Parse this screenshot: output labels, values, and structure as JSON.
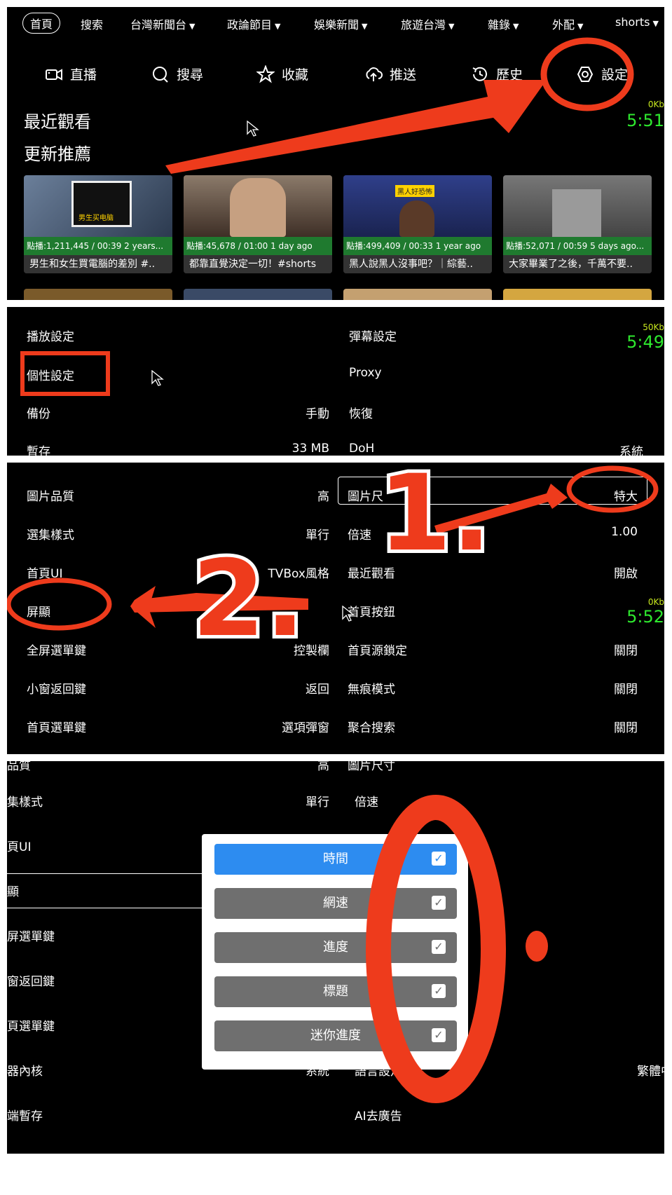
{
  "panel1": {
    "nav_tabs": [
      {
        "label": "首頁",
        "filter": ""
      },
      {
        "label": "搜索",
        "filter": ""
      },
      {
        "label": "台灣新聞台",
        "filter": "▼"
      },
      {
        "label": "政論節目",
        "filter": "▼"
      },
      {
        "label": "娛樂新聞",
        "filter": "▼"
      },
      {
        "label": "旅遊台灣",
        "filter": "▼"
      },
      {
        "label": "雜錄",
        "filter": "▼"
      },
      {
        "label": "外配",
        "filter": "▼"
      },
      {
        "label": "shorts",
        "filter": "▼"
      }
    ],
    "actions": [
      {
        "label": "直播",
        "icon": "camera-icon"
      },
      {
        "label": "搜尋",
        "icon": "search-icon"
      },
      {
        "label": "收藏",
        "icon": "star-icon"
      },
      {
        "label": "推送",
        "icon": "cloud-upload-icon"
      },
      {
        "label": "歷史",
        "icon": "history-icon"
      },
      {
        "label": "設定",
        "icon": "gear-icon"
      }
    ],
    "recent_title": "最近觀看",
    "recommend_title": "更新推薦",
    "speed": "0Kb",
    "clock": "5:51",
    "cards": [
      {
        "meta": "點播:1,211,445 / 00:39 2 years...",
        "title": "男生和女生買電腦的差別 #..",
        "thumb_text": "男生买电脑"
      },
      {
        "meta": "點播:45,678 / 01:00 1 day ago",
        "title": "都靠直覺決定一切！#shorts",
        "thumb_text": ""
      },
      {
        "meta": "點播:499,409 / 00:33 1 year ago",
        "title": "黑人說黑人沒事吧？｜綜藝..",
        "thumb_text": "黑人好恐怖"
      },
      {
        "meta": "點播:52,071 / 00:59 5 days ago...",
        "title": "大家畢業了之後，千萬不要..",
        "thumb_text": ""
      }
    ]
  },
  "panel2": {
    "speed": "50Kb",
    "clock": "5:49",
    "left_rows": [
      {
        "label": "播放設定",
        "value": ""
      },
      {
        "label": "個性設定",
        "value": ""
      },
      {
        "label": "備份",
        "value": "手動"
      },
      {
        "label": "暫存",
        "value": "33 MB"
      }
    ],
    "right_rows": [
      {
        "label": "彈幕設定",
        "value": ""
      },
      {
        "label": "Proxy",
        "value": ""
      },
      {
        "label": "恢復",
        "value": ""
      },
      {
        "label": "DoH",
        "value": "系統"
      }
    ]
  },
  "panel3": {
    "speed": "0Kb",
    "clock": "5:52",
    "annotation_1": "1.",
    "annotation_2": "2.",
    "left_rows": [
      {
        "label": "圖片品質",
        "value": "高"
      },
      {
        "label": "選集樣式",
        "value": "單行"
      },
      {
        "label": "首頁UI",
        "value": "TVBox風格"
      },
      {
        "label": "屏顯",
        "value": ""
      },
      {
        "label": "全屏選單鍵",
        "value": "控製欄"
      },
      {
        "label": "小窗返回鍵",
        "value": "返回"
      },
      {
        "label": "首頁選單鍵",
        "value": "選項彈窗"
      }
    ],
    "right_rows": [
      {
        "label": "圖片尺",
        "value": "特大"
      },
      {
        "label": "倍速",
        "value": "1.00"
      },
      {
        "label": "最近觀看",
        "value": "開啟"
      },
      {
        "label": "首頁按鈕",
        "value": ""
      },
      {
        "label": "首頁源鎖定",
        "value": "關閉"
      },
      {
        "label": "無痕模式",
        "value": "關閉"
      },
      {
        "label": "聚合搜索",
        "value": "關閉"
      }
    ]
  },
  "panel4": {
    "top_left": "品質",
    "top_left_val": "高",
    "top_right": "圖片尺寸",
    "annotation_3": "0.",
    "left_rows": [
      {
        "label": "集樣式",
        "value": "單行"
      },
      {
        "label": "頁UI",
        "value": ""
      },
      {
        "label": "顯",
        "value": ""
      },
      {
        "label": "屏選單鍵",
        "value": ""
      },
      {
        "label": "窗返回鍵",
        "value": ""
      },
      {
        "label": "頁選單鍵",
        "value": ""
      },
      {
        "label": "器內核",
        "value": "系統"
      },
      {
        "label": "端暫存",
        "value": ""
      }
    ],
    "right_rows": [
      {
        "label": "倍速",
        "value": ""
      },
      {
        "label": "",
        "value": ""
      },
      {
        "label": "",
        "value": ""
      },
      {
        "label": "",
        "value": ""
      },
      {
        "label": "",
        "value": ""
      },
      {
        "label": "",
        "value": ""
      },
      {
        "label": "語言設定",
        "value": "繁體中"
      },
      {
        "label": "AI去廣告",
        "value": ""
      }
    ],
    "dialog_options": [
      {
        "label": "時間",
        "checked": "✓",
        "selected": true
      },
      {
        "label": "網速",
        "checked": "✓",
        "selected": false
      },
      {
        "label": "進度",
        "checked": "✓",
        "selected": false
      },
      {
        "label": "標題",
        "checked": "✓",
        "selected": false
      },
      {
        "label": "迷你進度",
        "checked": "✓",
        "selected": false
      }
    ]
  },
  "colors": {
    "accent_red": "#ee3b1c",
    "selected_blue": "#2d8cf0",
    "clock_green": "#2ee82e",
    "meta_green": "#1f7a2f"
  }
}
